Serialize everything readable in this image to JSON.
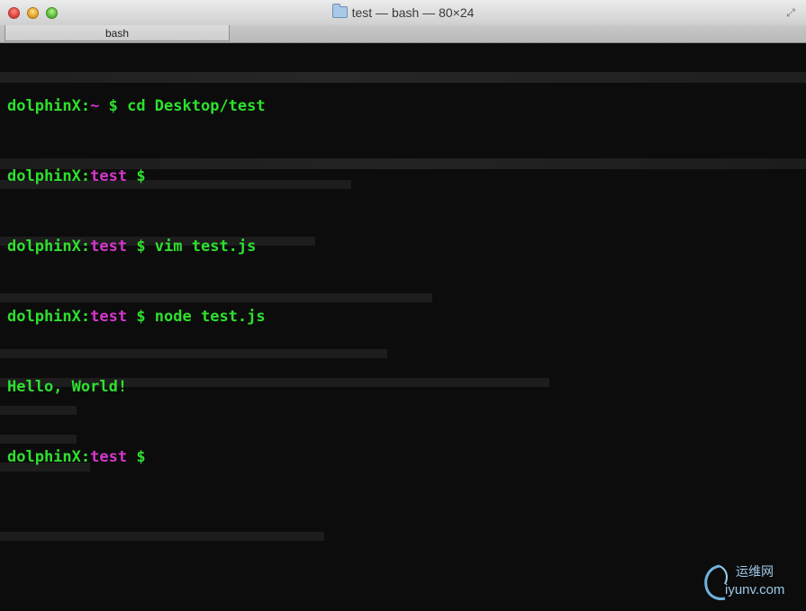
{
  "window": {
    "title": "test — bash — 80×24",
    "tab_label": "bash"
  },
  "terminal": {
    "lines": [
      {
        "host": "dolphinX:",
        "dir": "~",
        "sep": " $ ",
        "cmd": "cd Desktop/test"
      },
      {
        "host": "dolphinX:",
        "dir": "test",
        "sep": " $ ",
        "cmd": ""
      },
      {
        "host": "dolphinX:",
        "dir": "test",
        "sep": " $ ",
        "cmd": "vim test.js"
      },
      {
        "host": "dolphinX:",
        "dir": "test",
        "sep": " $ ",
        "cmd": "node test.js"
      },
      {
        "output": "Hello, World!"
      },
      {
        "host": "dolphinX:",
        "dir": "test",
        "sep": " $ ",
        "cmd": ""
      }
    ]
  },
  "watermark": {
    "cn": "运维网",
    "en": "iyunv.com"
  },
  "colors": {
    "prompt_green": "#2ee02e",
    "dir_magenta": "#d238c9",
    "background": "#0c0c0c"
  },
  "icons": {
    "close": "close-button-red",
    "minimize": "minimize-button-yellow",
    "zoom": "zoom-button-green",
    "folder": "folder-icon",
    "fullscreen": "fullscreen-arrows-icon"
  }
}
